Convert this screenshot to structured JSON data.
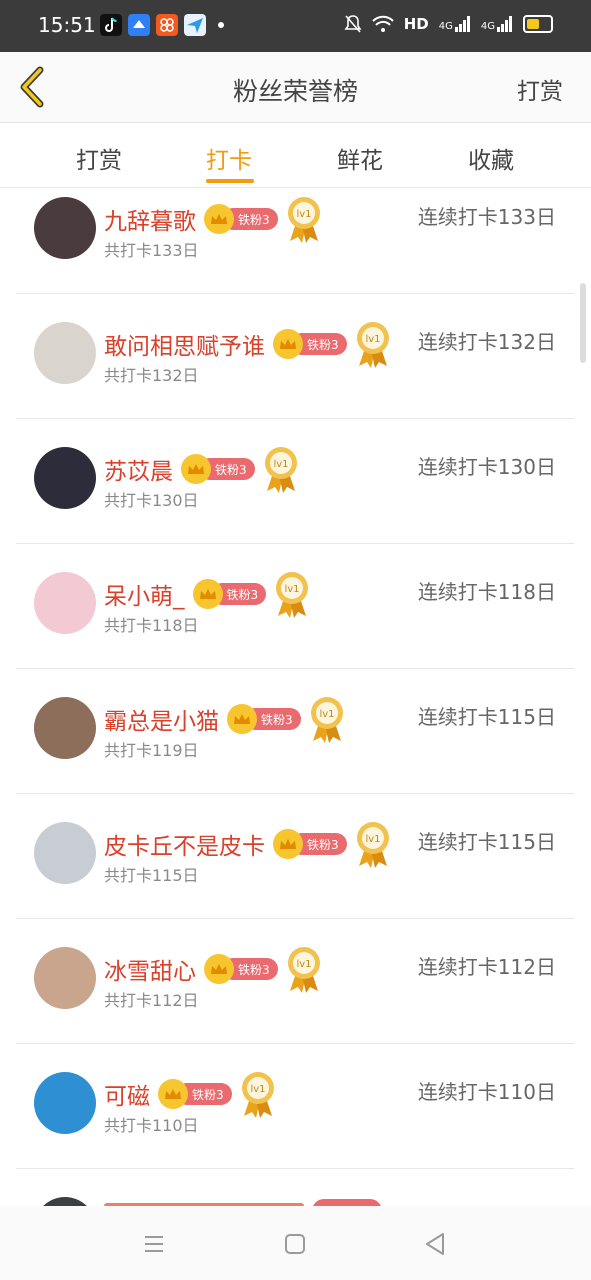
{
  "status_bar": {
    "time": "15:51",
    "network_label": "HD",
    "signal1_label": "4G",
    "signal2_label": "4G"
  },
  "header": {
    "title": "粉丝荣誉榜",
    "right_action": "打赏"
  },
  "tabs": [
    {
      "label": "打赏",
      "active": false
    },
    {
      "label": "打卡",
      "active": true
    },
    {
      "label": "鲜花",
      "active": false
    },
    {
      "label": "收藏",
      "active": false
    }
  ],
  "list": [
    {
      "name": "九辞暮歌",
      "badge": "铁粉3",
      "medal": "lv1",
      "total": "共打卡133日",
      "streak": "连续打卡133日",
      "avatar_color": "#4a3b3f"
    },
    {
      "name": "敢问相思赋予谁",
      "badge": "铁粉3",
      "medal": "lv1",
      "total": "共打卡132日",
      "streak": "连续打卡132日",
      "avatar_color": "#d9d4ce"
    },
    {
      "name": "苏苡晨",
      "badge": "铁粉3",
      "medal": "lv1",
      "total": "共打卡130日",
      "streak": "连续打卡130日",
      "avatar_color": "#2c2c3a"
    },
    {
      "name": "呆小萌_",
      "badge": "铁粉3",
      "medal": "lv1",
      "total": "共打卡118日",
      "streak": "连续打卡118日",
      "avatar_color": "#f3c9d4"
    },
    {
      "name": "霸总是小猫",
      "badge": "铁粉3",
      "medal": "lv1",
      "total": "共打卡119日",
      "streak": "连续打卡115日",
      "avatar_color": "#8c6e5a"
    },
    {
      "name": "皮卡丘不是皮卡",
      "badge": "铁粉3",
      "medal": "lv1",
      "total": "共打卡115日",
      "streak": "连续打卡115日",
      "avatar_color": "#c7cdd2"
    },
    {
      "name": "冰雪甜心",
      "badge": "铁粉3",
      "medal": "lv1",
      "total": "共打卡112日",
      "streak": "连续打卡112日",
      "avatar_color": "#c9a58d"
    },
    {
      "name": "可磁",
      "badge": "铁粉3",
      "medal": "lv1",
      "total": "共打卡110日",
      "streak": "连续打卡110日",
      "avatar_color": "#2f8fd3"
    }
  ],
  "colors": {
    "accent": "#f39c12",
    "name": "#d9412b",
    "badge": "#e96b6f",
    "crown": "#f7c52d"
  }
}
